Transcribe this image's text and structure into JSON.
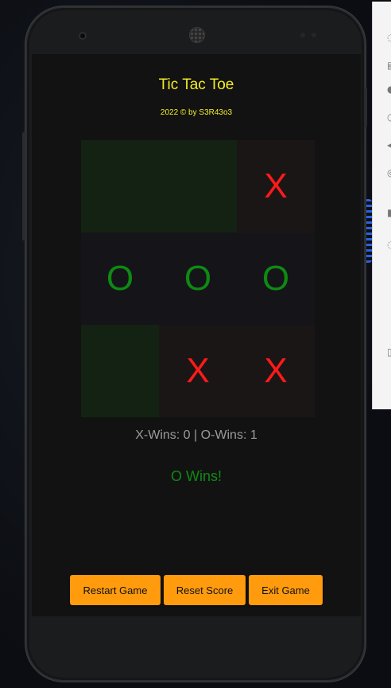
{
  "app": {
    "title": "Tic Tac Toe",
    "subtitle": "2022 © by S3R43o3"
  },
  "board": {
    "cells": [
      {
        "mark": "",
        "state": "win"
      },
      {
        "mark": "",
        "state": "win"
      },
      {
        "mark": "X",
        "state": "x"
      },
      {
        "mark": "O",
        "state": "o"
      },
      {
        "mark": "O",
        "state": "o"
      },
      {
        "mark": "O",
        "state": "o"
      },
      {
        "mark": "",
        "state": "win"
      },
      {
        "mark": "X",
        "state": "x"
      },
      {
        "mark": "X",
        "state": "x"
      }
    ]
  },
  "status": {
    "score_text": "X-Wins: 0 | O-Wins: 1",
    "result_text": "O Wins!"
  },
  "buttons": {
    "restart": "Restart Game",
    "reset": "Reset Score",
    "exit": "Exit Game"
  },
  "colors": {
    "accent_yellow": "#f4ee28",
    "x_color": "#ff1a1a",
    "o_color": "#0e8a12",
    "button": "#ff9b0d"
  }
}
